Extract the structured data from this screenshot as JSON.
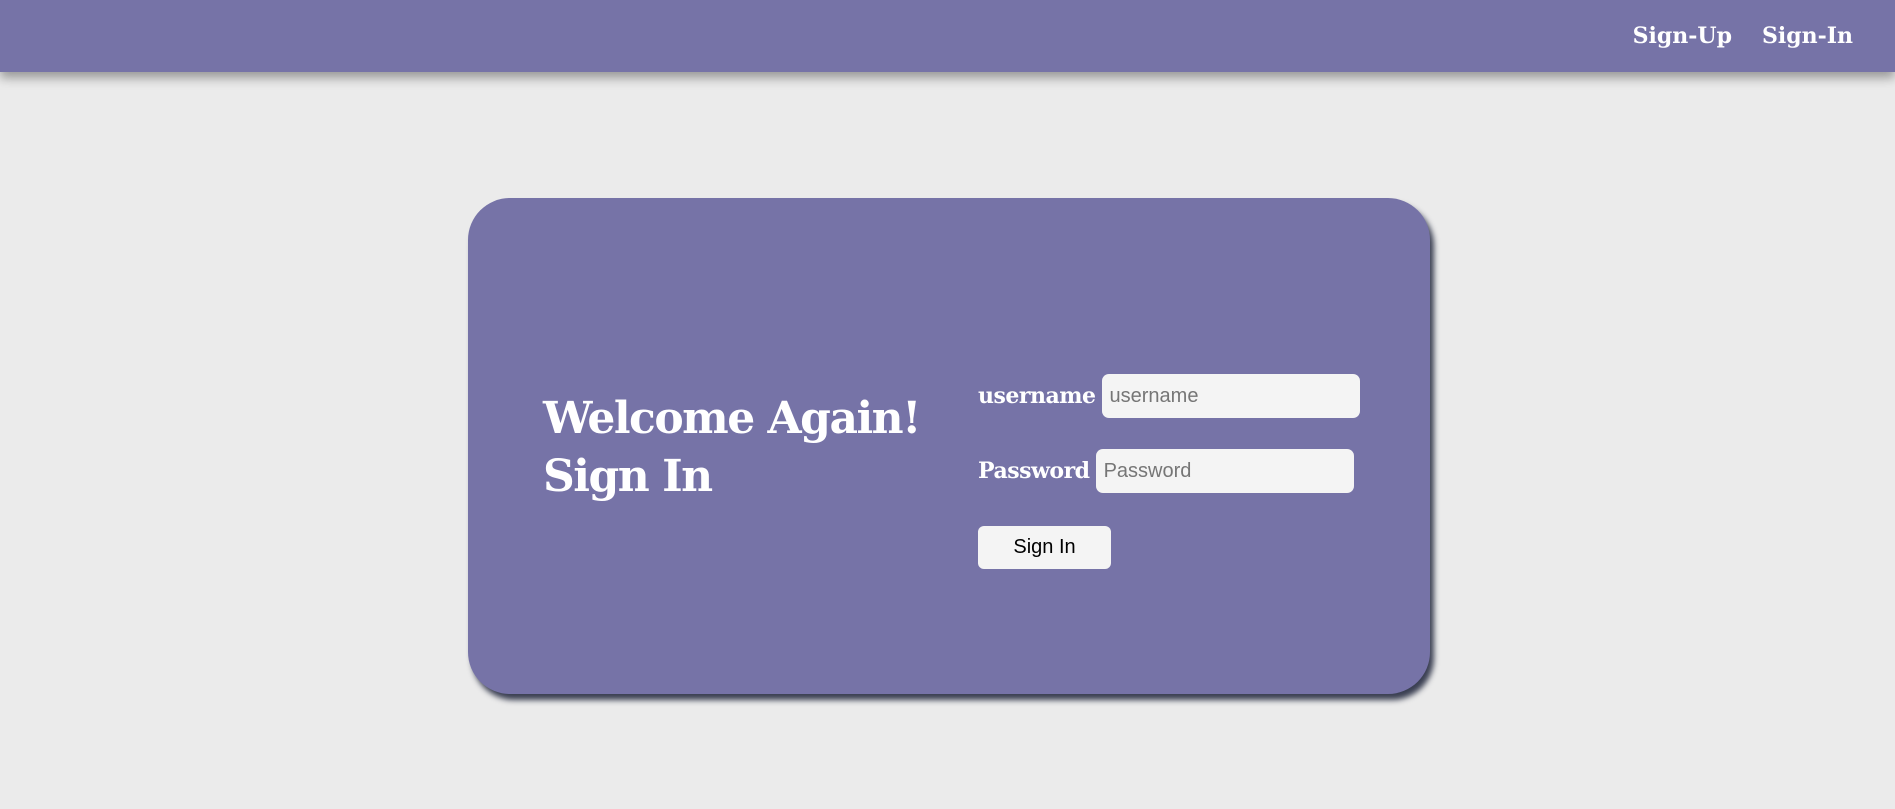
{
  "nav": {
    "signup_label": "Sign-Up",
    "signin_label": "Sign-In"
  },
  "card": {
    "heading_line1": "Welcome Again!",
    "heading_line2": "Sign In"
  },
  "form": {
    "username_label": "username",
    "username_placeholder": "username",
    "username_value": "",
    "password_label": "Password",
    "password_placeholder": "Password",
    "password_value": "",
    "submit_label": "Sign In"
  },
  "colors": {
    "brand": "#7673a7",
    "background": "#ebebeb",
    "input_bg": "#f4f4f4"
  }
}
